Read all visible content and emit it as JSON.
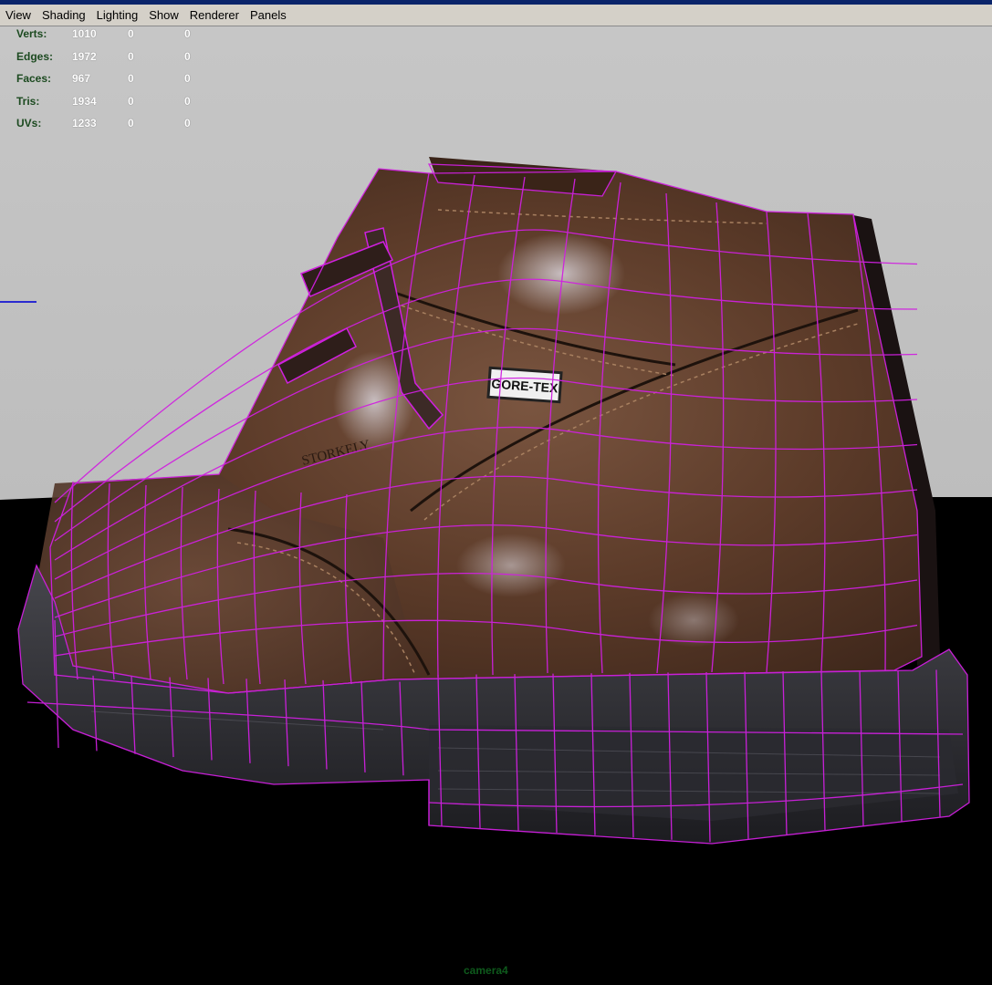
{
  "menu": [
    "View",
    "Shading",
    "Lighting",
    "Show",
    "Renderer",
    "Panels"
  ],
  "hud": {
    "rows": [
      {
        "label": "Verts:",
        "v1": "1010",
        "v2": "0",
        "v3": "0"
      },
      {
        "label": "Edges:",
        "v1": "1972",
        "v2": "0",
        "v3": "0"
      },
      {
        "label": "Faces:",
        "v1": "967",
        "v2": "0",
        "v3": "0"
      },
      {
        "label": "Tris:",
        "v1": "1934",
        "v2": "0",
        "v3": "0"
      },
      {
        "label": "UVs:",
        "v1": "1233",
        "v2": "0",
        "v3": "0"
      }
    ]
  },
  "model": {
    "badge_text": "GORE-TEX",
    "brand_text": "STORKELY"
  },
  "camera_label": "camera4",
  "colors": {
    "viewport_bg": "#c2c2c2",
    "ground": "#000000",
    "wireframe": "#d020e0",
    "leather": "#5a3a28",
    "sole": "#2e2e32",
    "menubar": "#d4d0c8"
  }
}
